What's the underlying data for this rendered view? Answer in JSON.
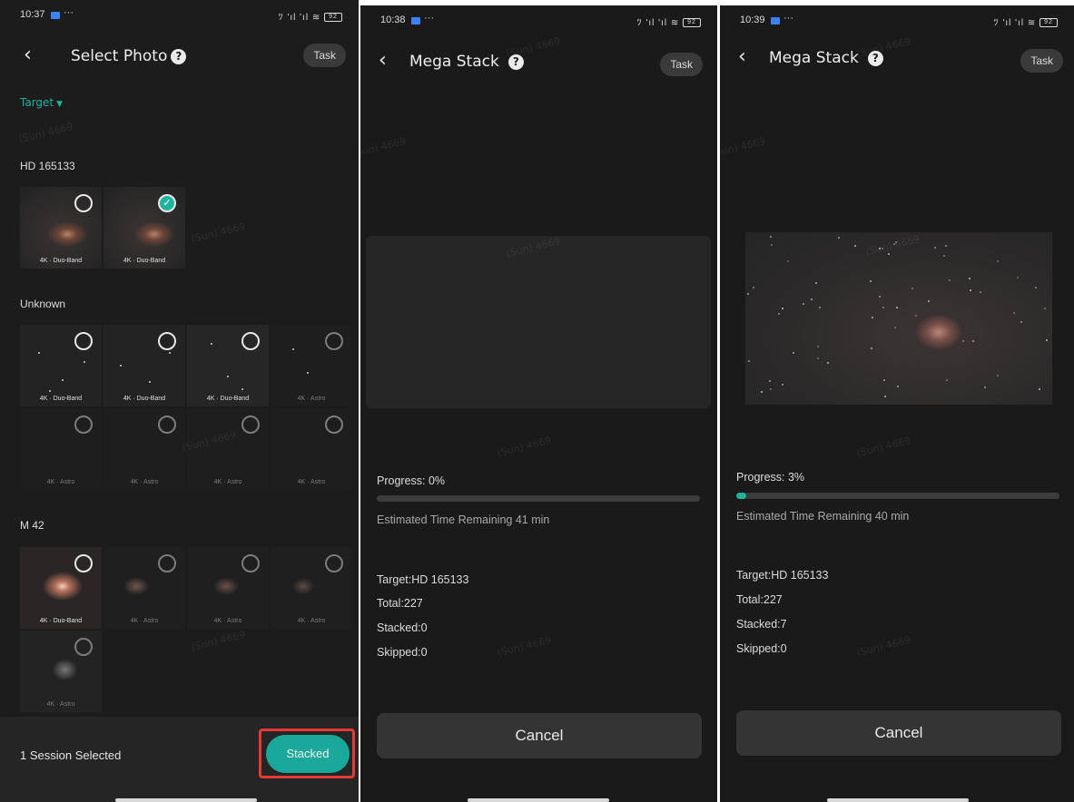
{
  "colors": {
    "accent": "#1aa89a",
    "highlight": "#e53935",
    "background": "#1b1b1b"
  },
  "screen1": {
    "status": {
      "time": "10:37",
      "icons": "ﾂ 'ıl 'ıl ≋",
      "battery": "92"
    },
    "title": "Select Photo",
    "help_icon": "?",
    "task_label": "Task",
    "filter_label": "Target",
    "groups": [
      {
        "name": "HD 165133",
        "thumbs": [
          {
            "tag": "4K · Duo-Band",
            "selected": false
          },
          {
            "tag": "4K · Duo-Band",
            "selected": true
          }
        ]
      },
      {
        "name": "Unknown",
        "thumbs": [
          {
            "tag": "4K · Duo-Band"
          },
          {
            "tag": "4K · Duo-Band"
          },
          {
            "tag": "4K · Duo-Band"
          },
          {
            "tag": "4K · Astro"
          },
          {
            "tag": "4K · Astro"
          },
          {
            "tag": "4K · Astro"
          },
          {
            "tag": "4K · Astro"
          },
          {
            "tag": "4K · Astro"
          }
        ]
      },
      {
        "name": "M 42",
        "thumbs": [
          {
            "tag": "4K · Duo-Band"
          },
          {
            "tag": "4K · Astro"
          },
          {
            "tag": "4K · Astro"
          },
          {
            "tag": "4K · Astro"
          },
          {
            "tag": "4K · Astro"
          }
        ]
      }
    ],
    "session_text": "1 Session Selected",
    "stacked_label": "Stacked",
    "check_glyph": "✓"
  },
  "screen2": {
    "status": {
      "time": "10:38",
      "icons": "ﾂ 'ıl 'ıl ≋",
      "battery": "92"
    },
    "title": "Mega Stack",
    "task_label": "Task",
    "progress_label": "Progress: 0%",
    "progress": 0,
    "eta": "Estimated Time Remaining 41 min",
    "target": "Target:HD 165133",
    "total": "Total:227",
    "stacked": "Stacked:0",
    "skipped": "Skipped:0",
    "cancel_label": "Cancel"
  },
  "screen3": {
    "status": {
      "time": "10:39",
      "icons": "ﾂ 'ıl 'ıl ≋",
      "battery": "92"
    },
    "title": "Mega Stack",
    "task_label": "Task",
    "progress_label": "Progress: 3%",
    "progress": 3,
    "eta": "Estimated Time Remaining 40 min",
    "target": "Target:HD 165133",
    "total": "Total:227",
    "stacked": "Stacked:7",
    "skipped": "Skipped:0",
    "cancel_label": "Cancel"
  }
}
